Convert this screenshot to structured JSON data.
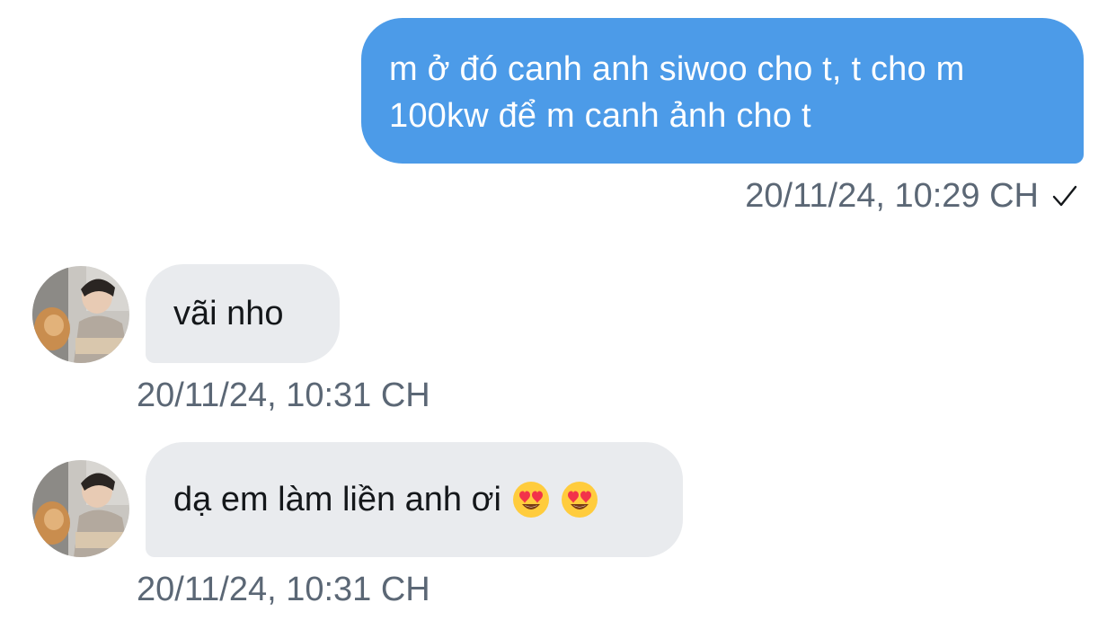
{
  "messages": [
    {
      "direction": "outgoing",
      "text_line1": "m ở đó canh anh siwoo cho t, t cho m",
      "text_line2": "100kw để m canh ảnh cho t",
      "timestamp": "20/11/24, 10:29 CH",
      "status_icon": "check-icon"
    },
    {
      "direction": "incoming",
      "text": "vãi nho",
      "timestamp": "20/11/24, 10:31 CH",
      "avatar": "avatar-photo"
    },
    {
      "direction": "incoming",
      "text": "dạ em làm liền anh ơi",
      "emojis": [
        "heart-eyes-emoji",
        "heart-eyes-emoji"
      ],
      "timestamp": "20/11/24, 10:31 CH",
      "avatar": "avatar-photo"
    }
  ],
  "colors": {
    "outgoing_bubble": "#4c9be8",
    "incoming_bubble": "#e9ebee",
    "timestamp_text": "#5b6775",
    "incoming_text": "#14171a"
  }
}
